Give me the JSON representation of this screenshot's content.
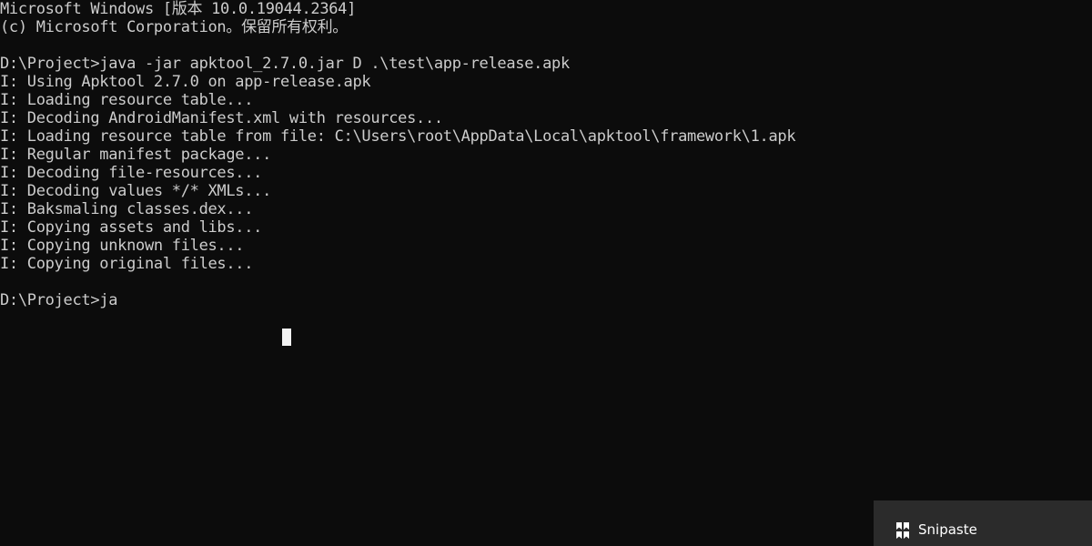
{
  "terminal": {
    "lines": [
      "Microsoft Windows [版本 10.0.19044.2364]",
      "(c) Microsoft Corporation。保留所有权利。",
      "",
      "D:\\Project>java -jar apktool_2.7.0.jar D .\\test\\app-release.apk",
      "I: Using Apktool 2.7.0 on app-release.apk",
      "I: Loading resource table...",
      "I: Decoding AndroidManifest.xml with resources...",
      "I: Loading resource table from file: C:\\Users\\root\\AppData\\Local\\apktool\\framework\\1.apk",
      "I: Regular manifest package...",
      "I: Decoding file-resources...",
      "I: Decoding values */* XMLs...",
      "I: Baksmaling classes.dex...",
      "I: Copying assets and libs...",
      "I: Copying unknown files...",
      "I: Copying original files...",
      "",
      "D:\\Project>ja"
    ]
  },
  "notification": {
    "title": "Snipaste",
    "icon": "snipaste-icon"
  },
  "colors": {
    "background": "#0c0c0c",
    "text": "#cccccc",
    "cursor": "#f2f2f2",
    "toast_background": "#2b2b2b",
    "toast_text": "#ffffff"
  }
}
